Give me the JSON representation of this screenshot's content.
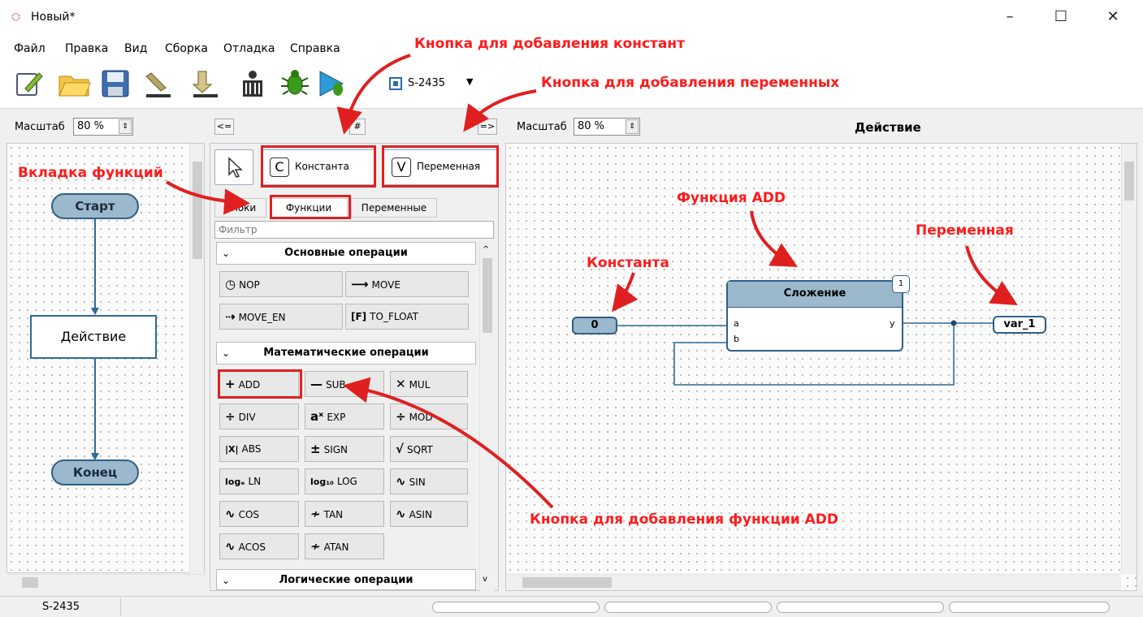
{
  "window": {
    "title": "Новый*",
    "minimize": "–",
    "maximize": "☐",
    "close": "✕"
  },
  "menu": [
    "Файл",
    "Правка",
    "Вид",
    "Сборка",
    "Отладка",
    "Справка"
  ],
  "toolbar": {
    "icons": [
      "new-file-icon",
      "open-folder-icon",
      "save-icon",
      "upload-icon",
      "download-icon",
      "build-icon",
      "debug-bug-icon",
      "run-debug-icon",
      "device-chip-icon"
    ],
    "device": "S-2435"
  },
  "left_panel": {
    "scale_label": "Масштаб",
    "scale_value": "80 %"
  },
  "flow": {
    "start": "Старт",
    "action": "Действие",
    "end": "Конец"
  },
  "palette_nav": {
    "left": "<=",
    "right": "=>",
    "mid": "#"
  },
  "palette": {
    "constant_label": "Константа",
    "constant_icon": "C",
    "variable_label": "Переменная",
    "variable_icon": "V",
    "tabs": [
      "Блоки",
      "Функции",
      "Переменные"
    ],
    "filter_placeholder": "Фильтр",
    "sections": [
      {
        "title": "Основные операции",
        "items": [
          {
            "icon": "◷",
            "label": "NOP"
          },
          {
            "icon": "⟶",
            "label": "MOVE"
          },
          {
            "icon": "⇢",
            "label": "MOVE_EN"
          },
          {
            "icon": "[F]",
            "label": "TO_FLOAT"
          }
        ]
      },
      {
        "title": "Математические операции",
        "items": [
          {
            "icon": "+",
            "label": "ADD"
          },
          {
            "icon": "—",
            "label": "SUB"
          },
          {
            "icon": "✕",
            "label": "MUL"
          },
          {
            "icon": "÷",
            "label": "DIV"
          },
          {
            "icon": "aˣ",
            "label": "EXP"
          },
          {
            "icon": "÷",
            "label": "MOD"
          },
          {
            "icon": "|X|",
            "label": "ABS"
          },
          {
            "icon": "±",
            "label": "SIGN"
          },
          {
            "icon": "√",
            "label": "SQRT"
          },
          {
            "icon": "logₑ",
            "label": "LN"
          },
          {
            "icon": "log₁₀",
            "label": "LOG"
          },
          {
            "icon": "∿",
            "label": "SIN"
          },
          {
            "icon": "∿",
            "label": "COS"
          },
          {
            "icon": "≁",
            "label": "TAN"
          },
          {
            "icon": "∿",
            "label": "ASIN"
          },
          {
            "icon": "∿",
            "label": "ACOS"
          },
          {
            "icon": "≁",
            "label": "ATAN"
          }
        ]
      },
      {
        "title": "Логические операции",
        "items": []
      }
    ]
  },
  "right_panel": {
    "scale_label": "Масштаб",
    "scale_value": "80 %",
    "title": "Действие"
  },
  "diagram": {
    "block_title": "Сложение",
    "block_badge": "1",
    "port_a": "a",
    "port_b": "b",
    "port_y": "y",
    "constant_value": "0",
    "variable_name": "var_1"
  },
  "annotations": {
    "add_constant": "Кнопка для добавления констант",
    "add_variable": "Кнопка для добавления переменных",
    "functions_tab": "Вкладка функций",
    "function_add": "Функция ADD",
    "variable": "Переменная",
    "constant": "Константа",
    "add_function_btn": "Кнопка для добавления функции ADD"
  },
  "status": {
    "device": "S-2435"
  },
  "colors": {
    "annotation": "#ff1a1a",
    "block_fill": "#9bb8cc",
    "block_border": "#2f5f86",
    "link": "#2f6b94"
  }
}
